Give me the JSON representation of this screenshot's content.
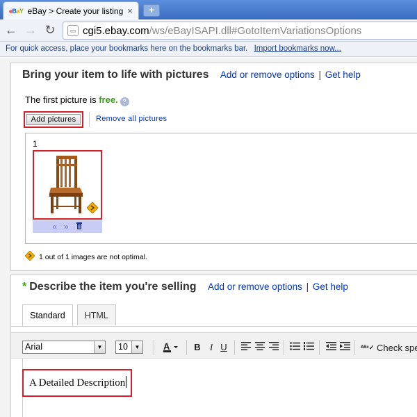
{
  "browser": {
    "tab_title": "eBay > Create your listing",
    "favicon": {
      "e": "e",
      "b": "B",
      "a": "a",
      "y": "Y"
    },
    "new_tab_label": "+",
    "url_host": "cgi5.ebay.com",
    "url_path": "/ws/eBayISAPI.dll#GotoItemVariationsOptions",
    "bookmarks_text": "For quick access, place your bookmarks here on the bookmarks bar.",
    "import_bookmarks_label": "Import bookmarks now..."
  },
  "pictures_section": {
    "title": "Bring your item to life with pictures",
    "add_remove_label": "Add or remove options",
    "separator": "|",
    "help_label": "Get help",
    "first_picture_prefix": "The first picture is ",
    "first_picture_free": "free.",
    "add_pictures_label": "Add pictures",
    "remove_all_label": "Remove all pictures",
    "picture_number": "1",
    "not_optimal_text": "1 out of 1 images are not optimal."
  },
  "describe_section": {
    "required_marker": "*",
    "title": "Describe the item you're selling",
    "add_remove_label": "Add or remove options",
    "separator": "|",
    "help_label": "Get help",
    "tabs": [
      {
        "label": "Standard"
      },
      {
        "label": "HTML"
      }
    ],
    "font_family": "Arial",
    "font_size": "10",
    "spell_check_label": "Check spe",
    "description_text": "A Detailed Description"
  },
  "colors": {
    "ebay_red": "#e53238",
    "ebay_blue": "#0064d2",
    "ebay_yellow": "#f5af02",
    "ebay_green": "#86b817",
    "highlight_red": "#d0202b",
    "link_blue": "#0033cc",
    "free_green": "#3a9a1a"
  }
}
